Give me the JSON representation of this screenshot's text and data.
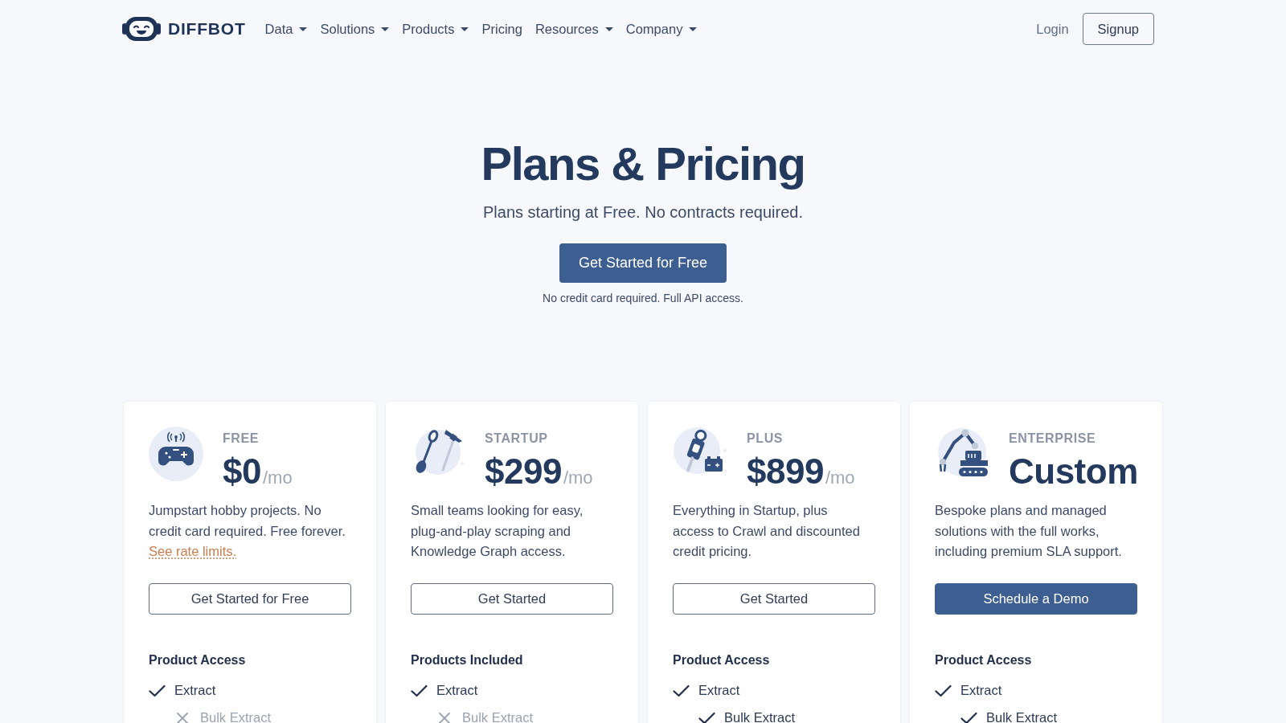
{
  "nav": {
    "brand": "DIFFBOT",
    "items": [
      {
        "label": "Data",
        "dropdown": true
      },
      {
        "label": "Solutions",
        "dropdown": true
      },
      {
        "label": "Products",
        "dropdown": true
      },
      {
        "label": "Pricing",
        "dropdown": false
      },
      {
        "label": "Resources",
        "dropdown": true
      },
      {
        "label": "Company",
        "dropdown": true
      }
    ],
    "login": "Login",
    "signup": "Signup"
  },
  "hero": {
    "title": "Plans & Pricing",
    "subtitle": "Plans starting at Free. No contracts required.",
    "cta": "Get Started for Free",
    "note": "No credit card required. Full API access."
  },
  "plans": [
    {
      "kind": "gamepad",
      "tier": "FREE",
      "price": "$0",
      "period": "/mo",
      "description": "Jumpstart hobby projects. No credit card required. Free forever.",
      "link": "See rate limits.",
      "button": {
        "label": "Get Started for Free",
        "primary": false
      },
      "features_title": "Product Access",
      "features": [
        {
          "label": "Extract",
          "included": true,
          "children": [
            {
              "label": "Bulk Extract",
              "included": false
            }
          ]
        }
      ]
    },
    {
      "kind": "tools",
      "tier": "STARTUP",
      "price": "$299",
      "period": "/mo",
      "description": "Small teams looking for easy, plug-and-play scraping and Knowledge Graph access.",
      "button": {
        "label": "Get Started",
        "primary": false
      },
      "features_title": "Products Included",
      "features": [
        {
          "label": "Extract",
          "included": true,
          "children": [
            {
              "label": "Bulk Extract",
              "included": false
            }
          ]
        }
      ]
    },
    {
      "kind": "plug",
      "tier": "PLUS",
      "price": "$899",
      "period": "/mo",
      "description": "Everything in Startup, plus access to Crawl and discounted credit pricing.",
      "button": {
        "label": "Get Started",
        "primary": false
      },
      "features_title": "Product Access",
      "features": [
        {
          "label": "Extract",
          "included": true,
          "children": [
            {
              "label": "Bulk Extract",
              "included": true
            }
          ]
        }
      ]
    },
    {
      "kind": "robot-arm",
      "tier": "ENTERPRISE",
      "price": "Custom",
      "description": "Bespoke plans and managed solutions with the full works, including premium SLA support.",
      "button": {
        "label": "Schedule a Demo",
        "primary": true
      },
      "features_title": "Product Access",
      "features": [
        {
          "label": "Extract",
          "included": true,
          "children": [
            {
              "label": "Bulk Extract",
              "included": true
            }
          ]
        }
      ]
    }
  ]
}
